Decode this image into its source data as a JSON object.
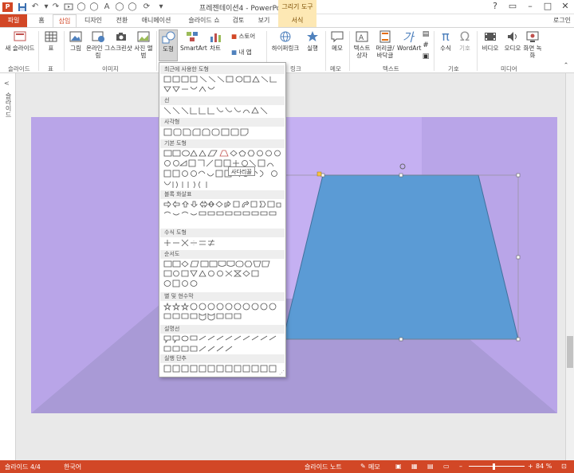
{
  "titlebar": {
    "title": "프레젠테이션4 - PowerPoint",
    "context_header": "그리기 도구",
    "app_logo": "P",
    "window_controls": [
      "?",
      "▭",
      "–",
      "□",
      "✕"
    ]
  },
  "tabs": {
    "file": "파일",
    "items": [
      "홈",
      "삽입",
      "디자인",
      "전환",
      "애니메이션",
      "슬라이드 쇼",
      "검토",
      "보기"
    ],
    "active": "삽입",
    "context_tab": "서식",
    "login": "로그인"
  },
  "ribbon": {
    "new_slide": "새 슬라이드",
    "table": "표",
    "picture": "그림",
    "online_picture": "온라인 그림",
    "screenshot": "스크린샷",
    "photo_album": "사진 앨범",
    "shapes": "도형",
    "smartart": "SmartArt",
    "chart": "차트",
    "store": "스토어",
    "my_apps": "내 앱",
    "hyperlink": "하이퍼링크",
    "action": "실행",
    "comment": "메모",
    "textbox": "텍스트 상자",
    "header_footer": "머리글/바닥글",
    "wordart": "WordArt",
    "equation": "수식",
    "symbol": "기호",
    "video": "비디오",
    "audio": "오디오",
    "screen_recording": "화면 녹화",
    "groups": {
      "slides": "슬라이드",
      "tables": "표",
      "images": "이미지",
      "links": "링크",
      "comments": "메모",
      "text": "텍스트",
      "symbols": "기호",
      "media": "미디어"
    }
  },
  "thumbpane": {
    "label": "슬라이드",
    "arrow": "<"
  },
  "shapes_menu": {
    "categories": [
      "최근에 사용한 도형",
      "선",
      "사각형",
      "기본 도형",
      "블록 화살표",
      "수식 도형",
      "순서도",
      "별 및 현수막",
      "설명선",
      "실행 단추"
    ],
    "tooltip": "사다리꼴",
    "grip": "⋰"
  },
  "statusbar": {
    "slide_indicator": "슬라이드 4/4",
    "language": "한국어",
    "notes": "슬라이드 노트",
    "comments": "메모",
    "zoom_minus": "–",
    "zoom_plus": "+",
    "zoom_percent": "84 %"
  },
  "colors": {
    "accent": "#d24726",
    "slide_background": "#c5b0f2",
    "floor": "#a99ad6",
    "trapezoid_fill": "#5b9bd5",
    "context_tab": "#fde8b4"
  }
}
